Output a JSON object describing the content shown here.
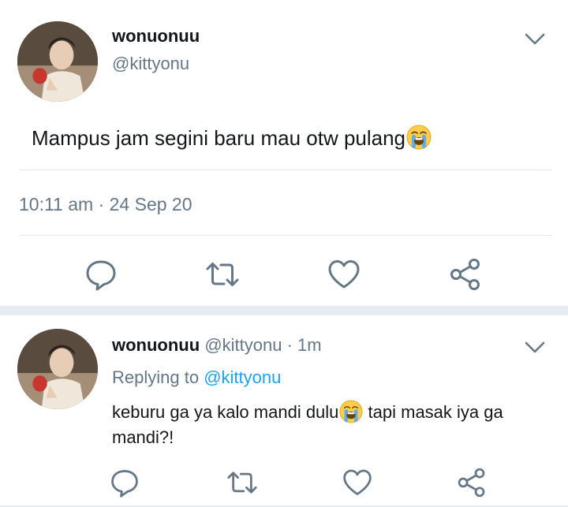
{
  "colors": {
    "text": "#14171a",
    "secondary": "#657786",
    "link": "#1da1f2",
    "divider": "#e1e8ed"
  },
  "main_tweet": {
    "display_name": "wonuonuu",
    "handle": "@kittyonu",
    "text": "Mampus jam segini baru mau otw pulang",
    "emoji": "loudly-crying-face",
    "timestamp": "10:11 am · 24 Sep 20",
    "actions": [
      "reply-icon",
      "retweet-icon",
      "like-icon",
      "share-icon"
    ]
  },
  "reply_tweet": {
    "display_name": "wonuonuu",
    "meta": "@kittyonu · 1m",
    "replying_prefix": "Replying to ",
    "replying_handle": "@kittyonu",
    "text_before_emoji": "keburu ga ya kalo mandi dulu",
    "emoji": "loudly-crying-face",
    "text_after_emoji": " tapi masak iya ga mandi?!",
    "actions": [
      "reply-icon",
      "retweet-icon",
      "like-icon",
      "share-icon"
    ]
  }
}
